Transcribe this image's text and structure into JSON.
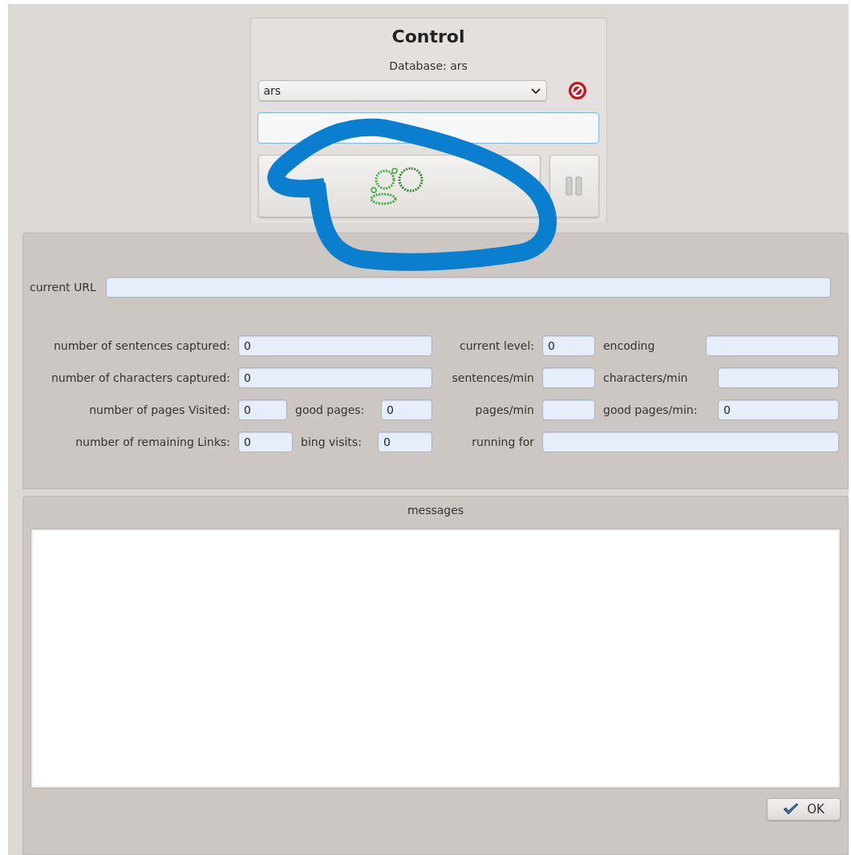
{
  "control": {
    "title": "Control",
    "database_label": "Database: ars",
    "database_select": "ars"
  },
  "current_url": {
    "label": "current URL"
  },
  "stats": {
    "rows": [
      {
        "left": [
          {
            "kind": "label",
            "text": "number of sentences captured:"
          },
          {
            "kind": "field",
            "value": "0"
          }
        ],
        "right": [
          {
            "kind": "label",
            "text": "current level:"
          },
          {
            "kind": "field",
            "value": "0"
          },
          {
            "kind": "label",
            "text": "encoding"
          },
          {
            "kind": "field"
          }
        ]
      },
      {
        "left": [
          {
            "kind": "label",
            "text": "number of characters captured:"
          },
          {
            "kind": "field",
            "value": "0"
          }
        ],
        "right": [
          {
            "kind": "label",
            "text": "sentences/min"
          },
          {
            "kind": "field"
          },
          {
            "kind": "label",
            "text": "characters/min"
          },
          {
            "kind": "field"
          }
        ]
      },
      {
        "left": [
          {
            "kind": "label",
            "text": "number of pages Visited:"
          },
          {
            "kind": "field",
            "value": "0"
          },
          {
            "kind": "label",
            "text": "good pages:"
          },
          {
            "kind": "field",
            "value": "0"
          }
        ],
        "right": [
          {
            "kind": "label",
            "text": "pages/min"
          },
          {
            "kind": "field"
          },
          {
            "kind": "label",
            "text": "good pages/min:"
          },
          {
            "kind": "field",
            "value": "0"
          }
        ]
      },
      {
        "left": [
          {
            "kind": "label",
            "text": "number of remaining Links:"
          },
          {
            "kind": "field",
            "value": "0"
          },
          {
            "kind": "label",
            "text": "bing visits:"
          },
          {
            "kind": "field",
            "value": "0"
          }
        ],
        "right": [
          {
            "kind": "label",
            "text": "running for"
          },
          {
            "kind": "field"
          }
        ]
      }
    ]
  },
  "messages": {
    "title": "messages",
    "ok_button": "OK"
  },
  "annotation": {
    "kind": "scribble"
  }
}
